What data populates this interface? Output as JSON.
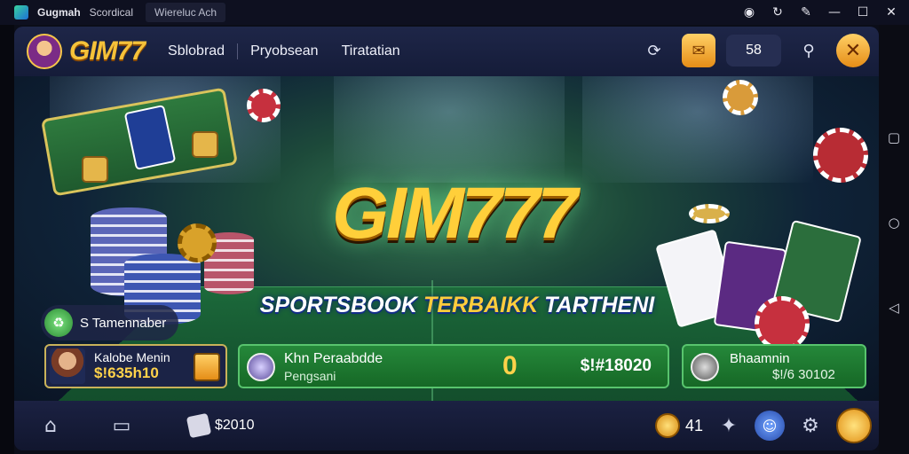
{
  "window": {
    "title": "Gugmah",
    "subtitle": "Scordical",
    "tab": "Wiereluc Ach",
    "controls": {
      "record": "◉",
      "history": "↻",
      "pen": "✎",
      "minimize": "—",
      "maximize": "☐",
      "close": "✕"
    }
  },
  "header": {
    "brand": "GIM77",
    "nav": [
      "Sblobrad",
      "Pryobsean",
      "Tiratatian"
    ],
    "balance": "58",
    "close": "✕"
  },
  "hero": {
    "title": "GIM777",
    "subtitle_white": "SPORTSBOOK ",
    "subtitle_gold": "TERBAIKK",
    "subtitle_end": " TARTHENI"
  },
  "promo": {
    "label": "S Tamennaber"
  },
  "info": {
    "user": {
      "name": "Kalobe Menin",
      "amount": "$!635h10"
    },
    "match": {
      "title": "Khn Peraabdde",
      "subtitle": "Pengsani",
      "score": "0",
      "value": "$!#18020"
    },
    "side": {
      "title": "Bhaamnin",
      "value": "$!/6 30102"
    }
  },
  "bottom": {
    "home": "⌂",
    "tabs": "▭",
    "wallet_value": "$2010",
    "coins": "41"
  },
  "android": {
    "back": "◁",
    "home": "○",
    "recents": "▢"
  },
  "colors": {
    "gold": "#ffcf3a",
    "green": "#25883a",
    "navy": "#151c39"
  }
}
